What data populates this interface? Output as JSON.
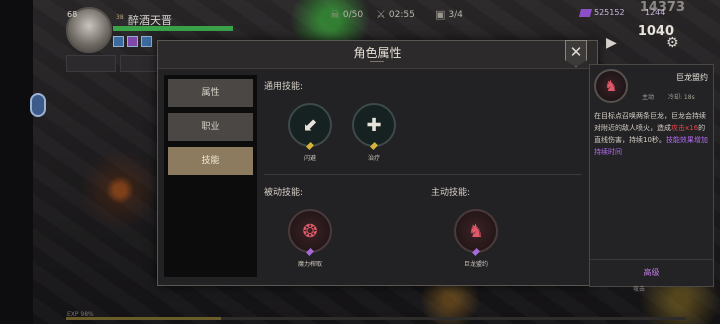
{
  "hud": {
    "level": "68",
    "player_name": "醉酒天晋",
    "level_tag": "38",
    "stats": [
      {
        "icon": "skull-icon",
        "value": "0/50"
      },
      {
        "icon": "swords-icon",
        "value": "02:55"
      },
      {
        "icon": "chest-icon",
        "value": "3/4"
      }
    ],
    "currency1": "525152",
    "currency2": "1244",
    "score_top": "14373",
    "score": "1040",
    "xp_label": "EXP 98%"
  },
  "dialog": {
    "title": "角色属性",
    "close_glyph": "✕",
    "tabs": [
      {
        "label": "属性"
      },
      {
        "label": "职业"
      },
      {
        "label": "技能"
      }
    ],
    "common_label": "通用技能:",
    "passive_label": "被动技能:",
    "active_label": "主动技能:",
    "common_skills": [
      {
        "name": "闪避",
        "icon": "boot-icon"
      },
      {
        "name": "治疗",
        "icon": "heal-heart-icon"
      }
    ],
    "passive_skills": [
      {
        "name": "魔力榨取",
        "icon": "mana-drain-icon"
      }
    ],
    "active_skills": [
      {
        "name": "巨龙盟约",
        "icon": "dragon-icon"
      }
    ]
  },
  "detail": {
    "name": "巨龙盟约",
    "type": "主动",
    "cooldown": "冷却: 18s",
    "desc_1": "在目标点召唤两条巨龙，巨龙会持续对附近的敌人喷火，造成",
    "desc_highlight": "攻击x16",
    "desc_2": "的直线伤害，持续10秒。",
    "desc_purple": "技能效果增加持续时间",
    "advanced": "高级",
    "bottom_label": "攻击"
  },
  "colors": {
    "active_tab": "#8d7b60",
    "highlight_red": "#e0454a",
    "purple": "#b36cef"
  }
}
